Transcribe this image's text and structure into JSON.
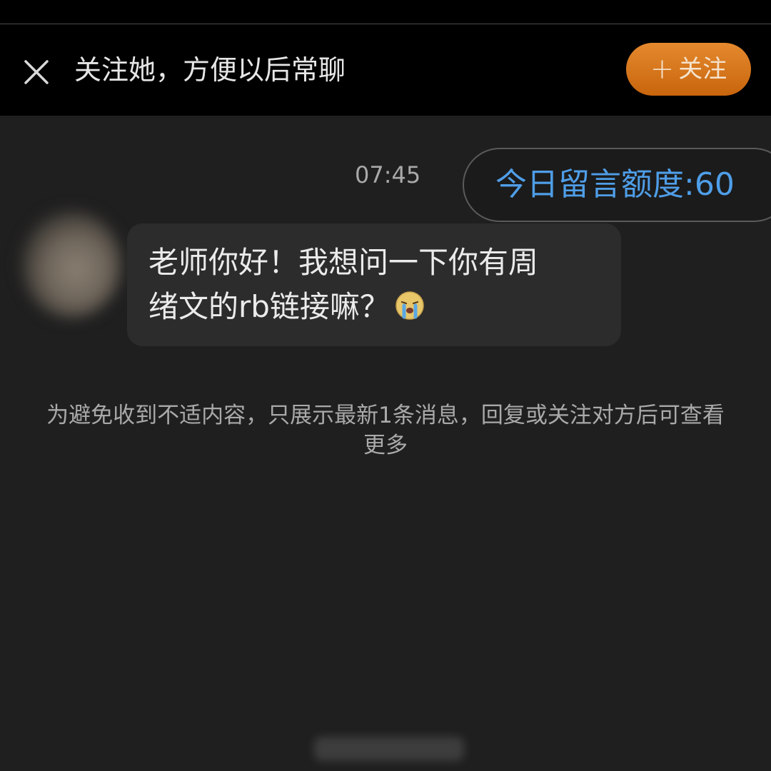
{
  "banner": {
    "text": "关注她，方便以后常聊",
    "follow_plus": "+",
    "follow_label": "关注"
  },
  "conversation": {
    "timestamp": "07:45",
    "quota": "今日留言额度:60",
    "message": {
      "line1": "老师你好！我想问一下你有周",
      "line2": "绪文的rb链接嘛？"
    },
    "notice": "为避免收到不适内容，只展示最新1条消息，回复或关注对方后可查看更多"
  },
  "colors": {
    "follow_button": "#d97a1f",
    "quota_text": "#4f9ee8",
    "background": "#1f1f1f"
  },
  "icons": {
    "close": "close-icon",
    "emoji": "crying-emoji-icon"
  }
}
